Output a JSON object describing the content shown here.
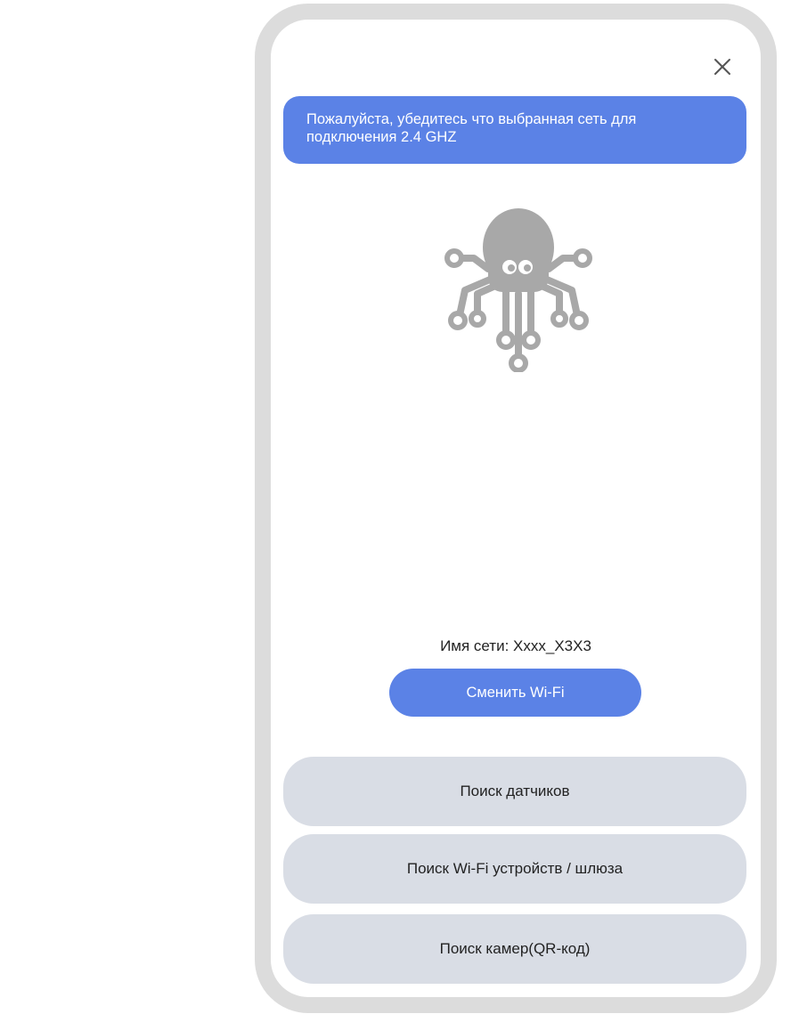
{
  "dialog": {
    "close_icon": "close-icon",
    "banner_text": "Пожалуйста, убедитесь что выбранная сеть для подключения 2.4 GHZ",
    "illustration_icon": "octopus-icon"
  },
  "network": {
    "label": "Имя сети:",
    "name": "Xxxx_X3X3",
    "change_button_label": "Сменить Wi-Fi"
  },
  "search_buttons": [
    {
      "label": "Поиск датчиков"
    },
    {
      "label": "Поиск Wi-Fi устройств / шлюза"
    },
    {
      "label": "Поиск камер(QR-код)"
    }
  ],
  "colors": {
    "accent": "#5b82e6",
    "secondary_button": "#d9dde5",
    "frame": "#dcdcdc",
    "icon_gray": "#a8a8a8"
  }
}
